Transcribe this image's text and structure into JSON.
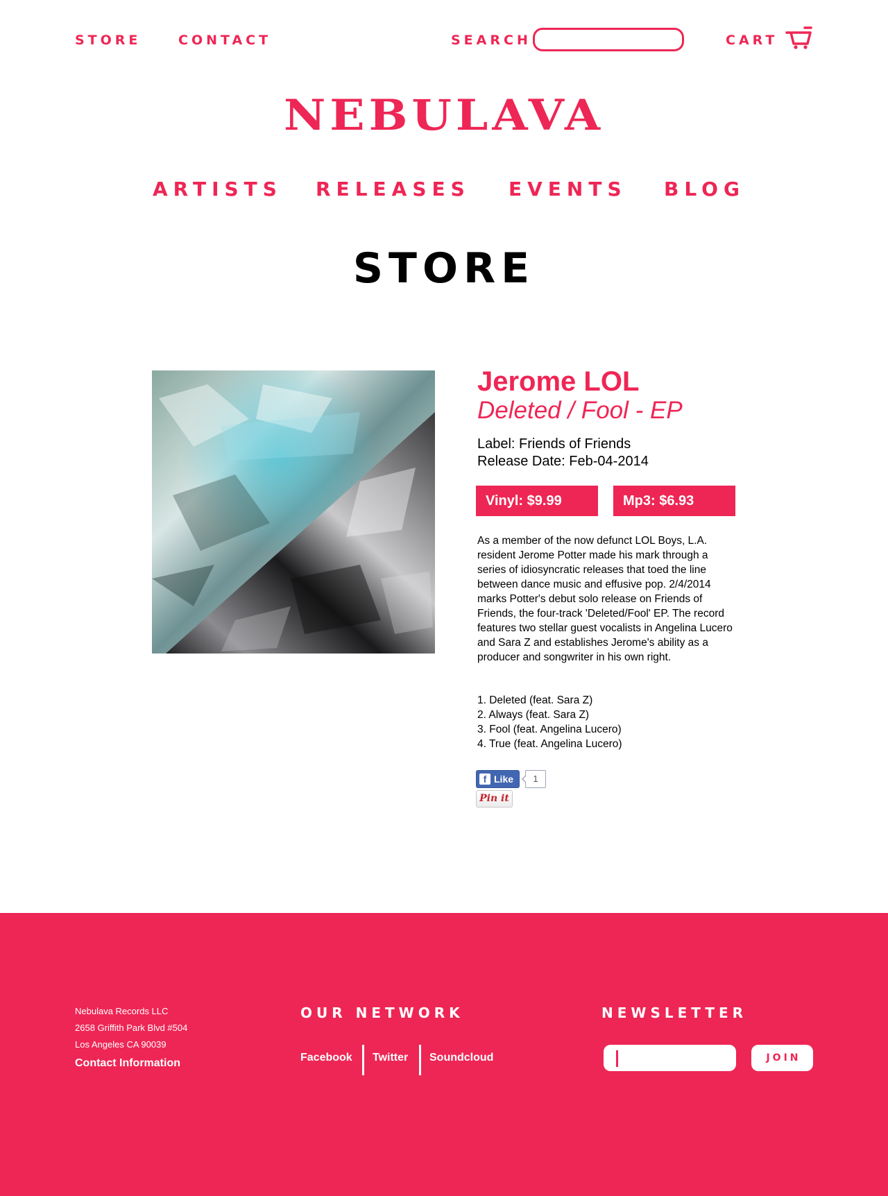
{
  "topnav": {
    "store_label": "STORE",
    "contact_label": "CONTACT",
    "search_label": "SEARCH",
    "search_value": "",
    "cart_label": "CART",
    "cart_icon": "shopping-cart-icon"
  },
  "brand": {
    "logo_text": "NEBULAVA"
  },
  "mainnav": {
    "artists": "ARTISTS",
    "releases": "RELEASES",
    "events": "EVENTS",
    "blog": "BLOG"
  },
  "page": {
    "title": "STORE"
  },
  "product": {
    "artist": "Jerome LOL",
    "release": "Deleted / Fool - EP",
    "label_line": "Label: Friends of Friends",
    "release_date_line": "Release Date: Feb-04-2014",
    "vinyl_price": "Vinyl: $9.99",
    "mp3_price": "Mp3: $6.93",
    "description": "As a member of the now defunct LOL Boys, L.A. resident Jerome Potter made his mark through a series of idiosyncratic releases that toed the line between dance music and effusive pop. 2/4/2014 marks Potter's debut solo release on Friends of Friends, the four-track 'Deleted/Fool' EP. The record features two stellar guest vocalists in Angelina Lucero and Sara Z and establishes Jerome's ability as a producer and songwriter in his own right.",
    "tracks": [
      "1. Deleted (feat. Sara Z)",
      "2. Always (feat. Sara Z)",
      "3. Fool (feat. Angelina Lucero)",
      "4. True (feat. Angelina Lucero)"
    ]
  },
  "social": {
    "fb_like_label": "Like",
    "fb_like_count": "1",
    "pin_label": "Pin it"
  },
  "footer": {
    "company": "Nebulava Records LLC",
    "address_line1": "2658 Griffith Park Blvd #504",
    "address_line2": "Los Angeles CA 90039",
    "contact_link": "Contact Information",
    "network_heading": "OUR NETWORK",
    "network_links": [
      "Facebook",
      "Twitter",
      "Soundcloud"
    ],
    "newsletter_heading": "NEWSLETTER",
    "newsletter_value": "",
    "join_label": "JOIN"
  },
  "colors": {
    "brand_pink": "#ee2655",
    "text": "#000000",
    "background": "#ffffff"
  }
}
